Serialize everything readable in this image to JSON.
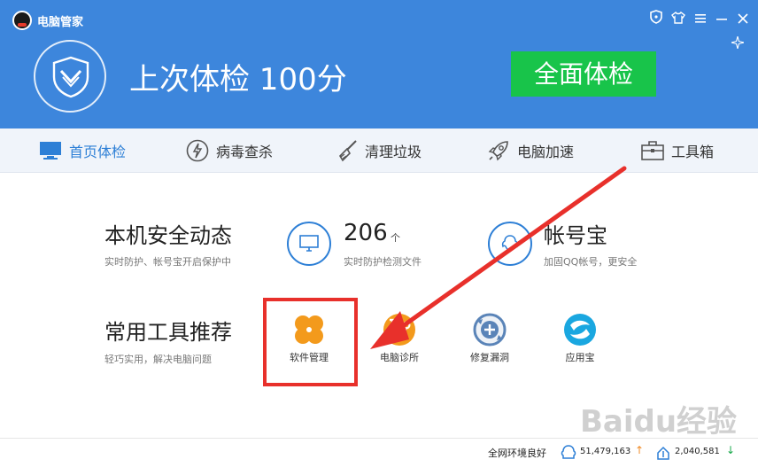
{
  "titlebar": {
    "app_title": "电脑管家",
    "buttons": [
      "shield-icon",
      "shirt-icon",
      "menu-icon",
      "minimize-icon",
      "close-icon"
    ]
  },
  "hero": {
    "score_text": "上次体检 100分",
    "full_check_label": "全面体检"
  },
  "nav": {
    "items": [
      {
        "label": "首页体检",
        "icon": "monitor-icon",
        "active": true
      },
      {
        "label": "病毒查杀",
        "icon": "lightning-icon",
        "active": false
      },
      {
        "label": "清理垃圾",
        "icon": "broom-icon",
        "active": false
      },
      {
        "label": "电脑加速",
        "icon": "rocket-icon",
        "active": false
      },
      {
        "label": "工具箱",
        "icon": "toolbox-icon",
        "active": false
      }
    ]
  },
  "security": {
    "title": "本机安全动态",
    "subtitle": "实时防护、帐号宝开启保护中",
    "files_value": "206",
    "files_unit": "个",
    "files_sub": "实时防护检测文件",
    "account_title": "帐号宝",
    "account_sub": "加固QQ帐号，更安全"
  },
  "tools": {
    "title": "常用工具推荐",
    "subtitle": "轻巧实用，解决电脑问题",
    "items": [
      {
        "label": "软件管理",
        "icon": "clover-icon"
      },
      {
        "label": "电脑诊所",
        "icon": "stethoscope-icon"
      },
      {
        "label": "修复漏洞",
        "icon": "repair-icon"
      },
      {
        "label": "应用宝",
        "icon": "app-store-icon"
      }
    ]
  },
  "status": {
    "network": "全网环境良好",
    "up_count": "51,479,163",
    "down_count": "2,040,581"
  },
  "watermark": "Baidu经验",
  "colors": {
    "header_blue": "#3d86dc",
    "check_green": "#18c44a",
    "active_blue": "#2d7fd6",
    "highlight_red": "#e8302b",
    "tool_orange": "#f39a1c",
    "tool_cyan": "#1aa7e0"
  }
}
